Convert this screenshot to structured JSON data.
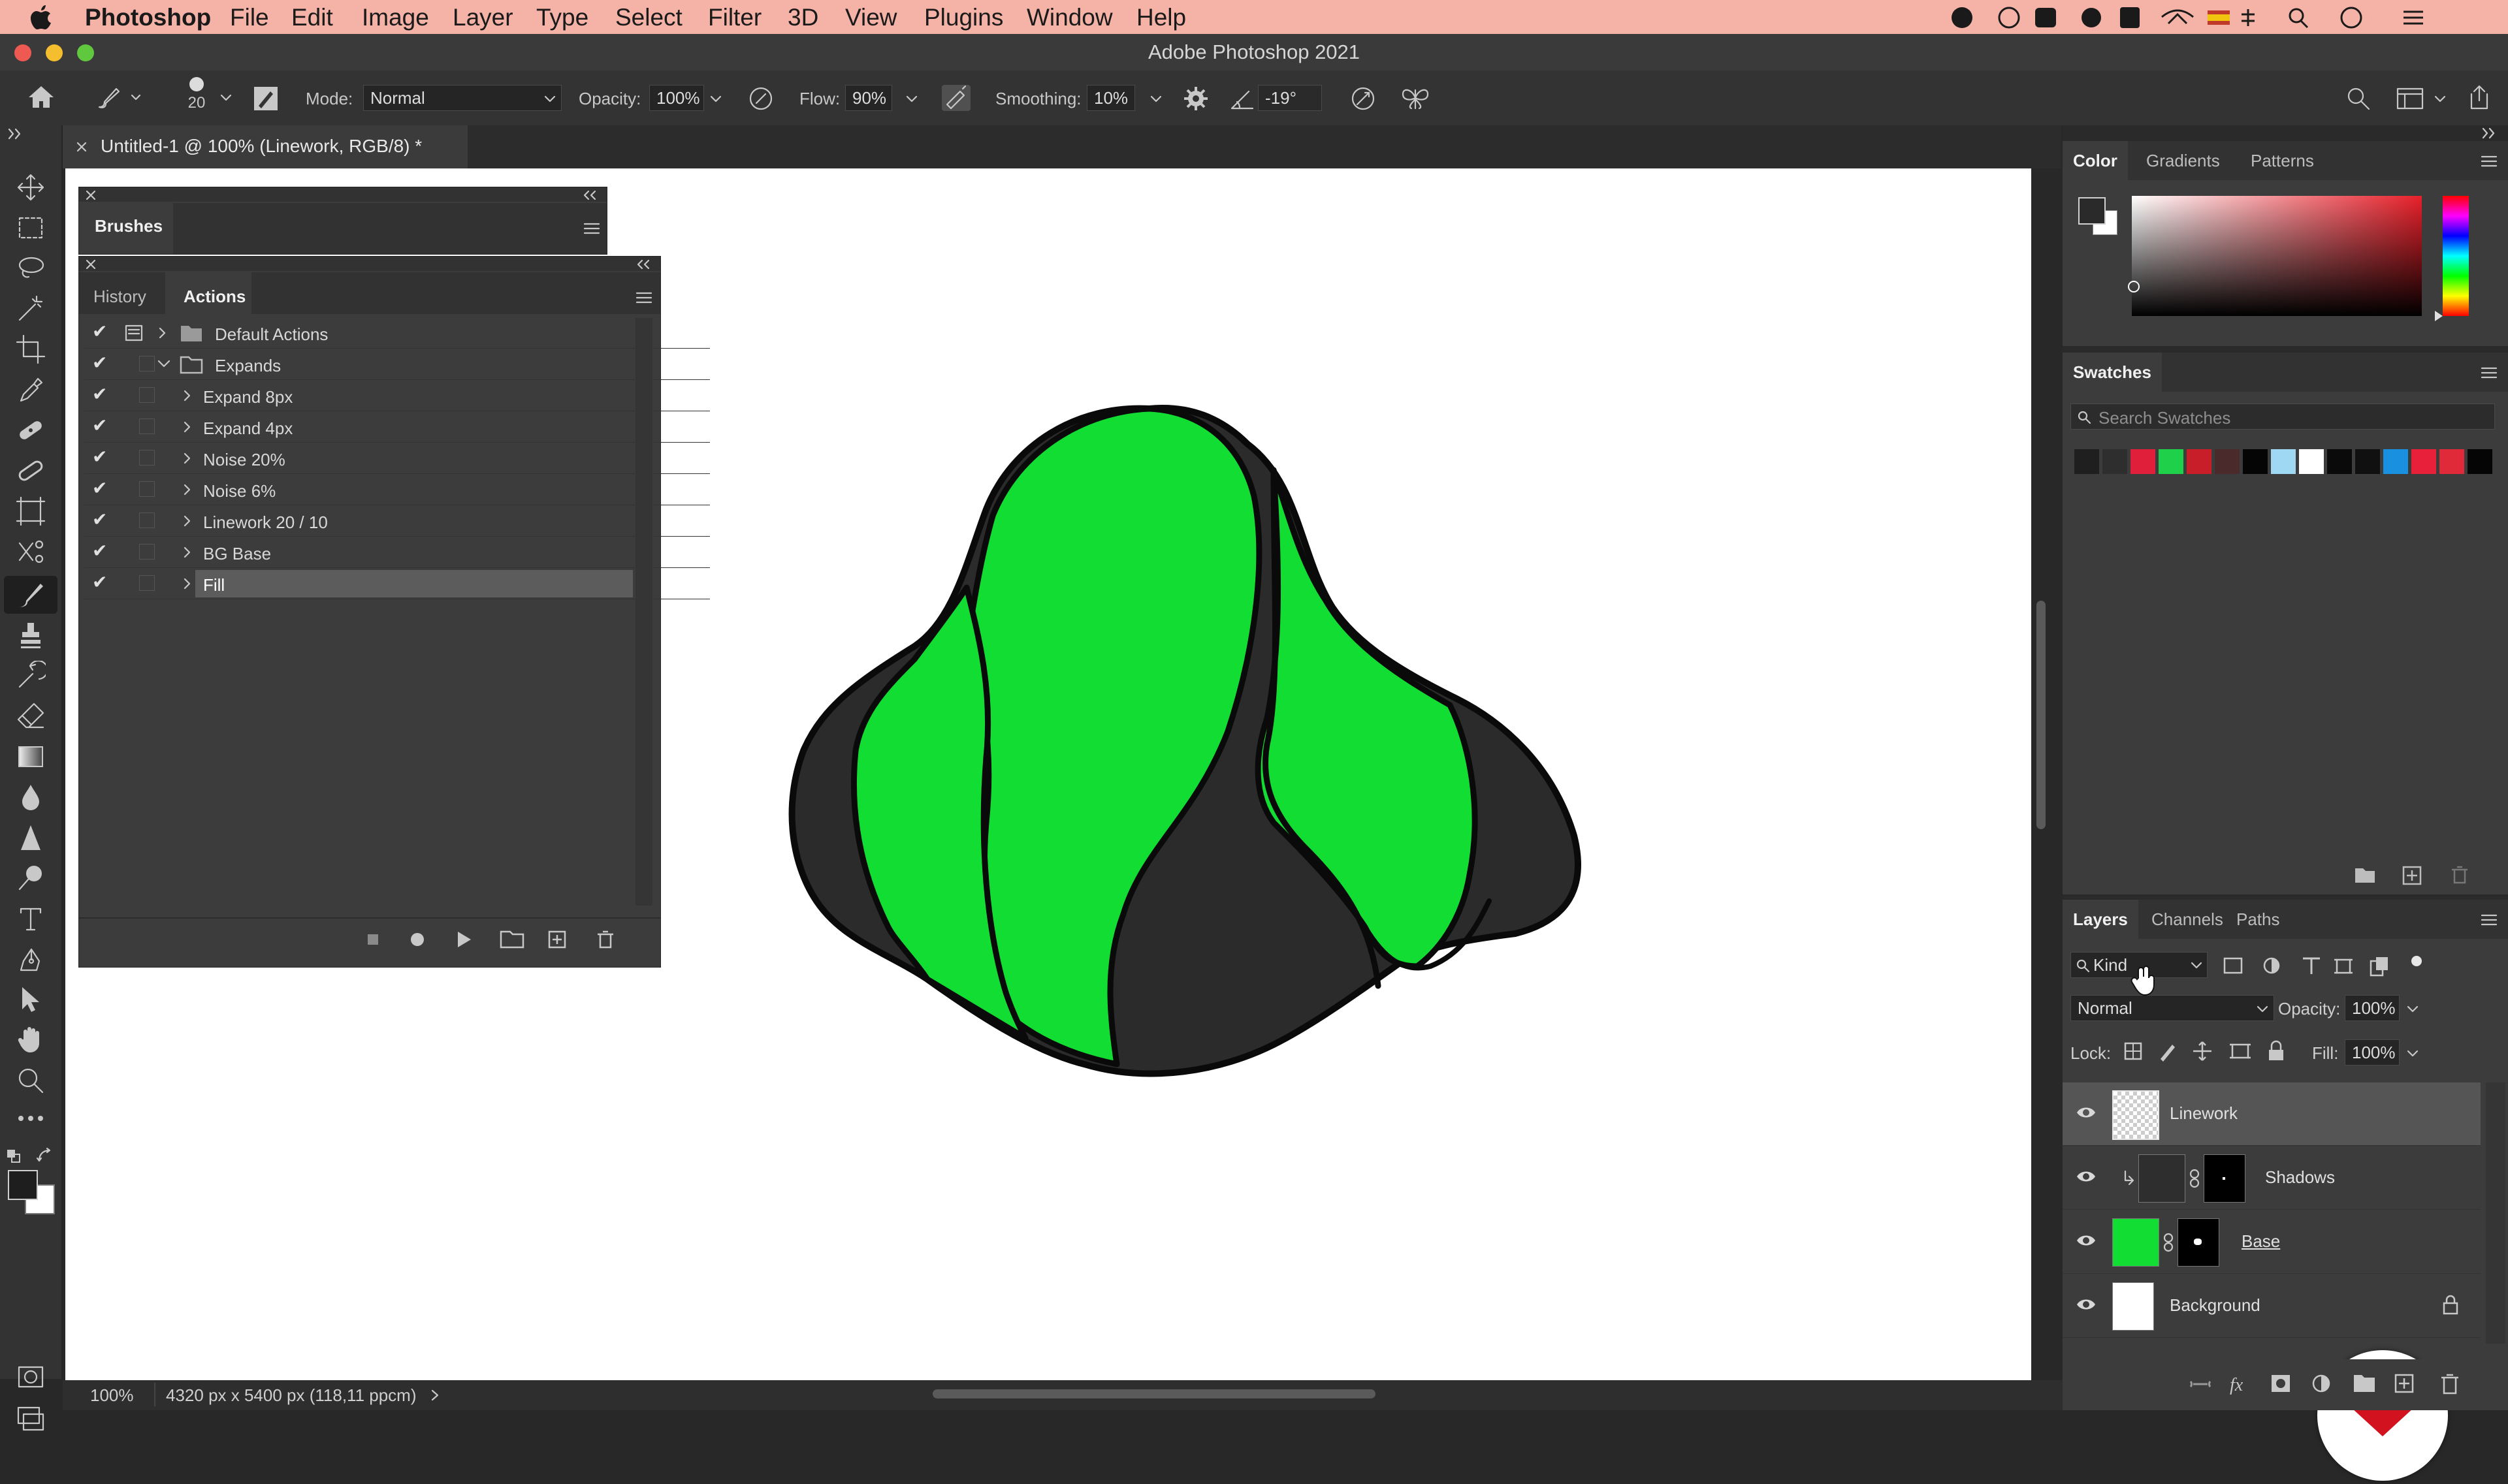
{
  "menubar": {
    "app_name": "Photoshop",
    "items": [
      "File",
      "Edit",
      "Image",
      "Layer",
      "Type",
      "Select",
      "Filter",
      "3D",
      "View",
      "Plugins",
      "Window",
      "Help"
    ]
  },
  "window": {
    "title": "Adobe Photoshop 2021"
  },
  "options": {
    "brush_size": "20",
    "mode_label": "Mode:",
    "mode_value": "Normal",
    "opacity_label": "Opacity:",
    "opacity_value": "100%",
    "flow_label": "Flow:",
    "flow_value": "90%",
    "smoothing_label": "Smoothing:",
    "smoothing_value": "10%",
    "angle_value": "-19°"
  },
  "document": {
    "tab_label": "Untitled-1 @ 100% (Linework, RGB/8) *",
    "zoom": "100%",
    "size_info": "4320 px x 5400 px (118,11 ppcm)"
  },
  "brushes_panel": {
    "title": "Brushes"
  },
  "actions_panel": {
    "tabs": [
      "History",
      "Actions"
    ],
    "active_tab": "Actions",
    "rows": [
      {
        "label": "Default Actions",
        "kind": "set",
        "expanded": false
      },
      {
        "label": "Expands",
        "kind": "set",
        "expanded": true
      },
      {
        "label": "Expand 8px",
        "kind": "action"
      },
      {
        "label": "Expand 4px",
        "kind": "action"
      },
      {
        "label": "Noise 20%",
        "kind": "action"
      },
      {
        "label": "Noise 6%",
        "kind": "action"
      },
      {
        "label": "Linework 20 / 10",
        "kind": "action"
      },
      {
        "label": "BG Base",
        "kind": "action"
      },
      {
        "label": "Fill",
        "kind": "action",
        "selected": true
      }
    ]
  },
  "color_panel": {
    "tabs": [
      "Color",
      "Gradients",
      "Patterns"
    ],
    "active_tab": "Color",
    "foreground": "#2a2a2a",
    "background": "#ffffff",
    "hue_color": "#e8202a"
  },
  "swatches_panel": {
    "title": "Swatches",
    "search_placeholder": "Search Swatches",
    "colors": [
      "#1f1f1f",
      "#2e2e2e",
      "#e0203a",
      "#1ed04a",
      "#c81e2a",
      "#4a2a2a",
      "#050505",
      "#9fd8f2",
      "#ffffff",
      "#0a0a0a",
      "#101010",
      "#1a90e0",
      "#e8203a",
      "#e02a3a",
      "#050505"
    ]
  },
  "layers_panel": {
    "tabs": [
      "Layers",
      "Channels",
      "Paths"
    ],
    "active_tab": "Layers",
    "filter_kind": "Kind",
    "blend_mode": "Normal",
    "opacity_label": "Opacity:",
    "opacity_value": "100%",
    "lock_label": "Lock:",
    "fill_label": "Fill:",
    "fill_value": "100%",
    "layers": [
      {
        "name": "Linework",
        "thumb": "transparent",
        "selected": true,
        "visible": true
      },
      {
        "name": "Shadows",
        "thumb": "#2e2e2e",
        "has_mask": true,
        "clipped": true,
        "visible": true
      },
      {
        "name": "Base",
        "thumb": "#12dd33",
        "has_mask": true,
        "visible": true
      },
      {
        "name": "Background",
        "thumb": "#ffffff",
        "locked": true,
        "visible": true
      }
    ]
  },
  "artwork": {
    "green": "#12dd33",
    "shadow": "#2b2b2b",
    "outline": "#0a0a0a"
  }
}
